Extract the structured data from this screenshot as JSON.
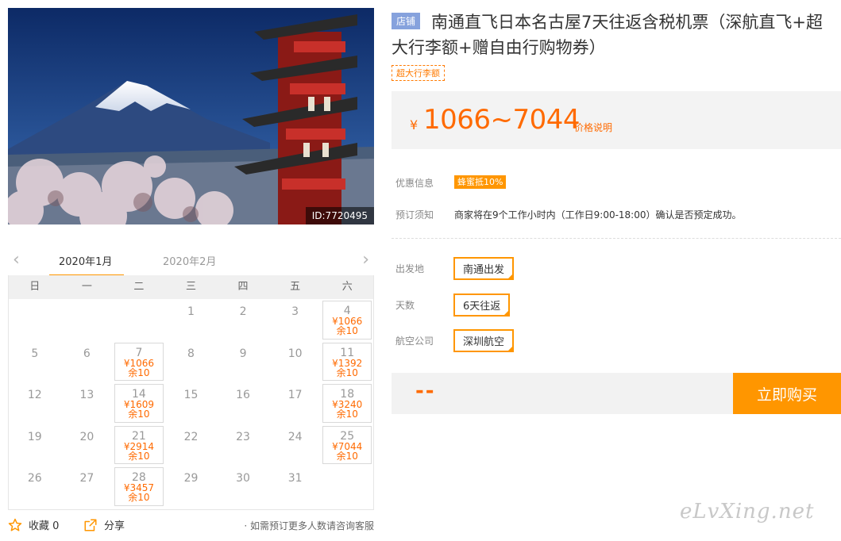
{
  "hero": {
    "image_id": "ID:7720495"
  },
  "calendar": {
    "months": [
      "2020年1月",
      "2020年2月"
    ],
    "weekdays": [
      "日",
      "一",
      "二",
      "三",
      "四",
      "五",
      "六"
    ],
    "leading_blanks": 3,
    "days": [
      {
        "d": "1"
      },
      {
        "d": "2"
      },
      {
        "d": "3"
      },
      {
        "d": "4",
        "price": "¥1066",
        "stock": "余10"
      },
      {
        "d": "5"
      },
      {
        "d": "6"
      },
      {
        "d": "7",
        "price": "¥1066",
        "stock": "余10"
      },
      {
        "d": "8"
      },
      {
        "d": "9"
      },
      {
        "d": "10"
      },
      {
        "d": "11",
        "price": "¥1392",
        "stock": "余10"
      },
      {
        "d": "12"
      },
      {
        "d": "13"
      },
      {
        "d": "14",
        "price": "¥1609",
        "stock": "余10"
      },
      {
        "d": "15"
      },
      {
        "d": "16"
      },
      {
        "d": "17"
      },
      {
        "d": "18",
        "price": "¥3240",
        "stock": "余10"
      },
      {
        "d": "19"
      },
      {
        "d": "20"
      },
      {
        "d": "21",
        "price": "¥2914",
        "stock": "余10"
      },
      {
        "d": "22"
      },
      {
        "d": "23"
      },
      {
        "d": "24"
      },
      {
        "d": "25",
        "price": "¥7044",
        "stock": "余10"
      },
      {
        "d": "26"
      },
      {
        "d": "27"
      },
      {
        "d": "28",
        "price": "¥3457",
        "stock": "余10"
      },
      {
        "d": "29"
      },
      {
        "d": "30"
      },
      {
        "d": "31"
      }
    ]
  },
  "footer": {
    "favorite_label": "收藏 0",
    "share_label": "分享",
    "note": "· 如需预订更多人数请咨询客服"
  },
  "product": {
    "shop_badge": "店铺",
    "title": "南通直飞日本名古屋7天往返含税机票（深航直飞+超大行李额+赠自由行购物券）",
    "tag": "超大行李额",
    "currency": "¥",
    "price_range": "1066~7044",
    "price_link": "价格说明"
  },
  "info": {
    "promo_label": "优惠信息",
    "promo_value": "蜂蜜抵10%",
    "notice_label": "预订须知",
    "notice_value": "商家将在9个工作小时内（工作日9:00-18:00）确认是否预定成功。"
  },
  "options": {
    "departure_label": "出发地",
    "departure_value": "南通出发",
    "days_label": "天数",
    "days_value": "6天往返",
    "airline_label": "航空公司",
    "airline_value": "深圳航空"
  },
  "buy": {
    "total": "--",
    "button": "立即购买"
  },
  "watermark": "eLvXing.net",
  "colors": {
    "accent": "#ff9600",
    "price": "#ff6a00",
    "badge": "#86a2dd"
  }
}
